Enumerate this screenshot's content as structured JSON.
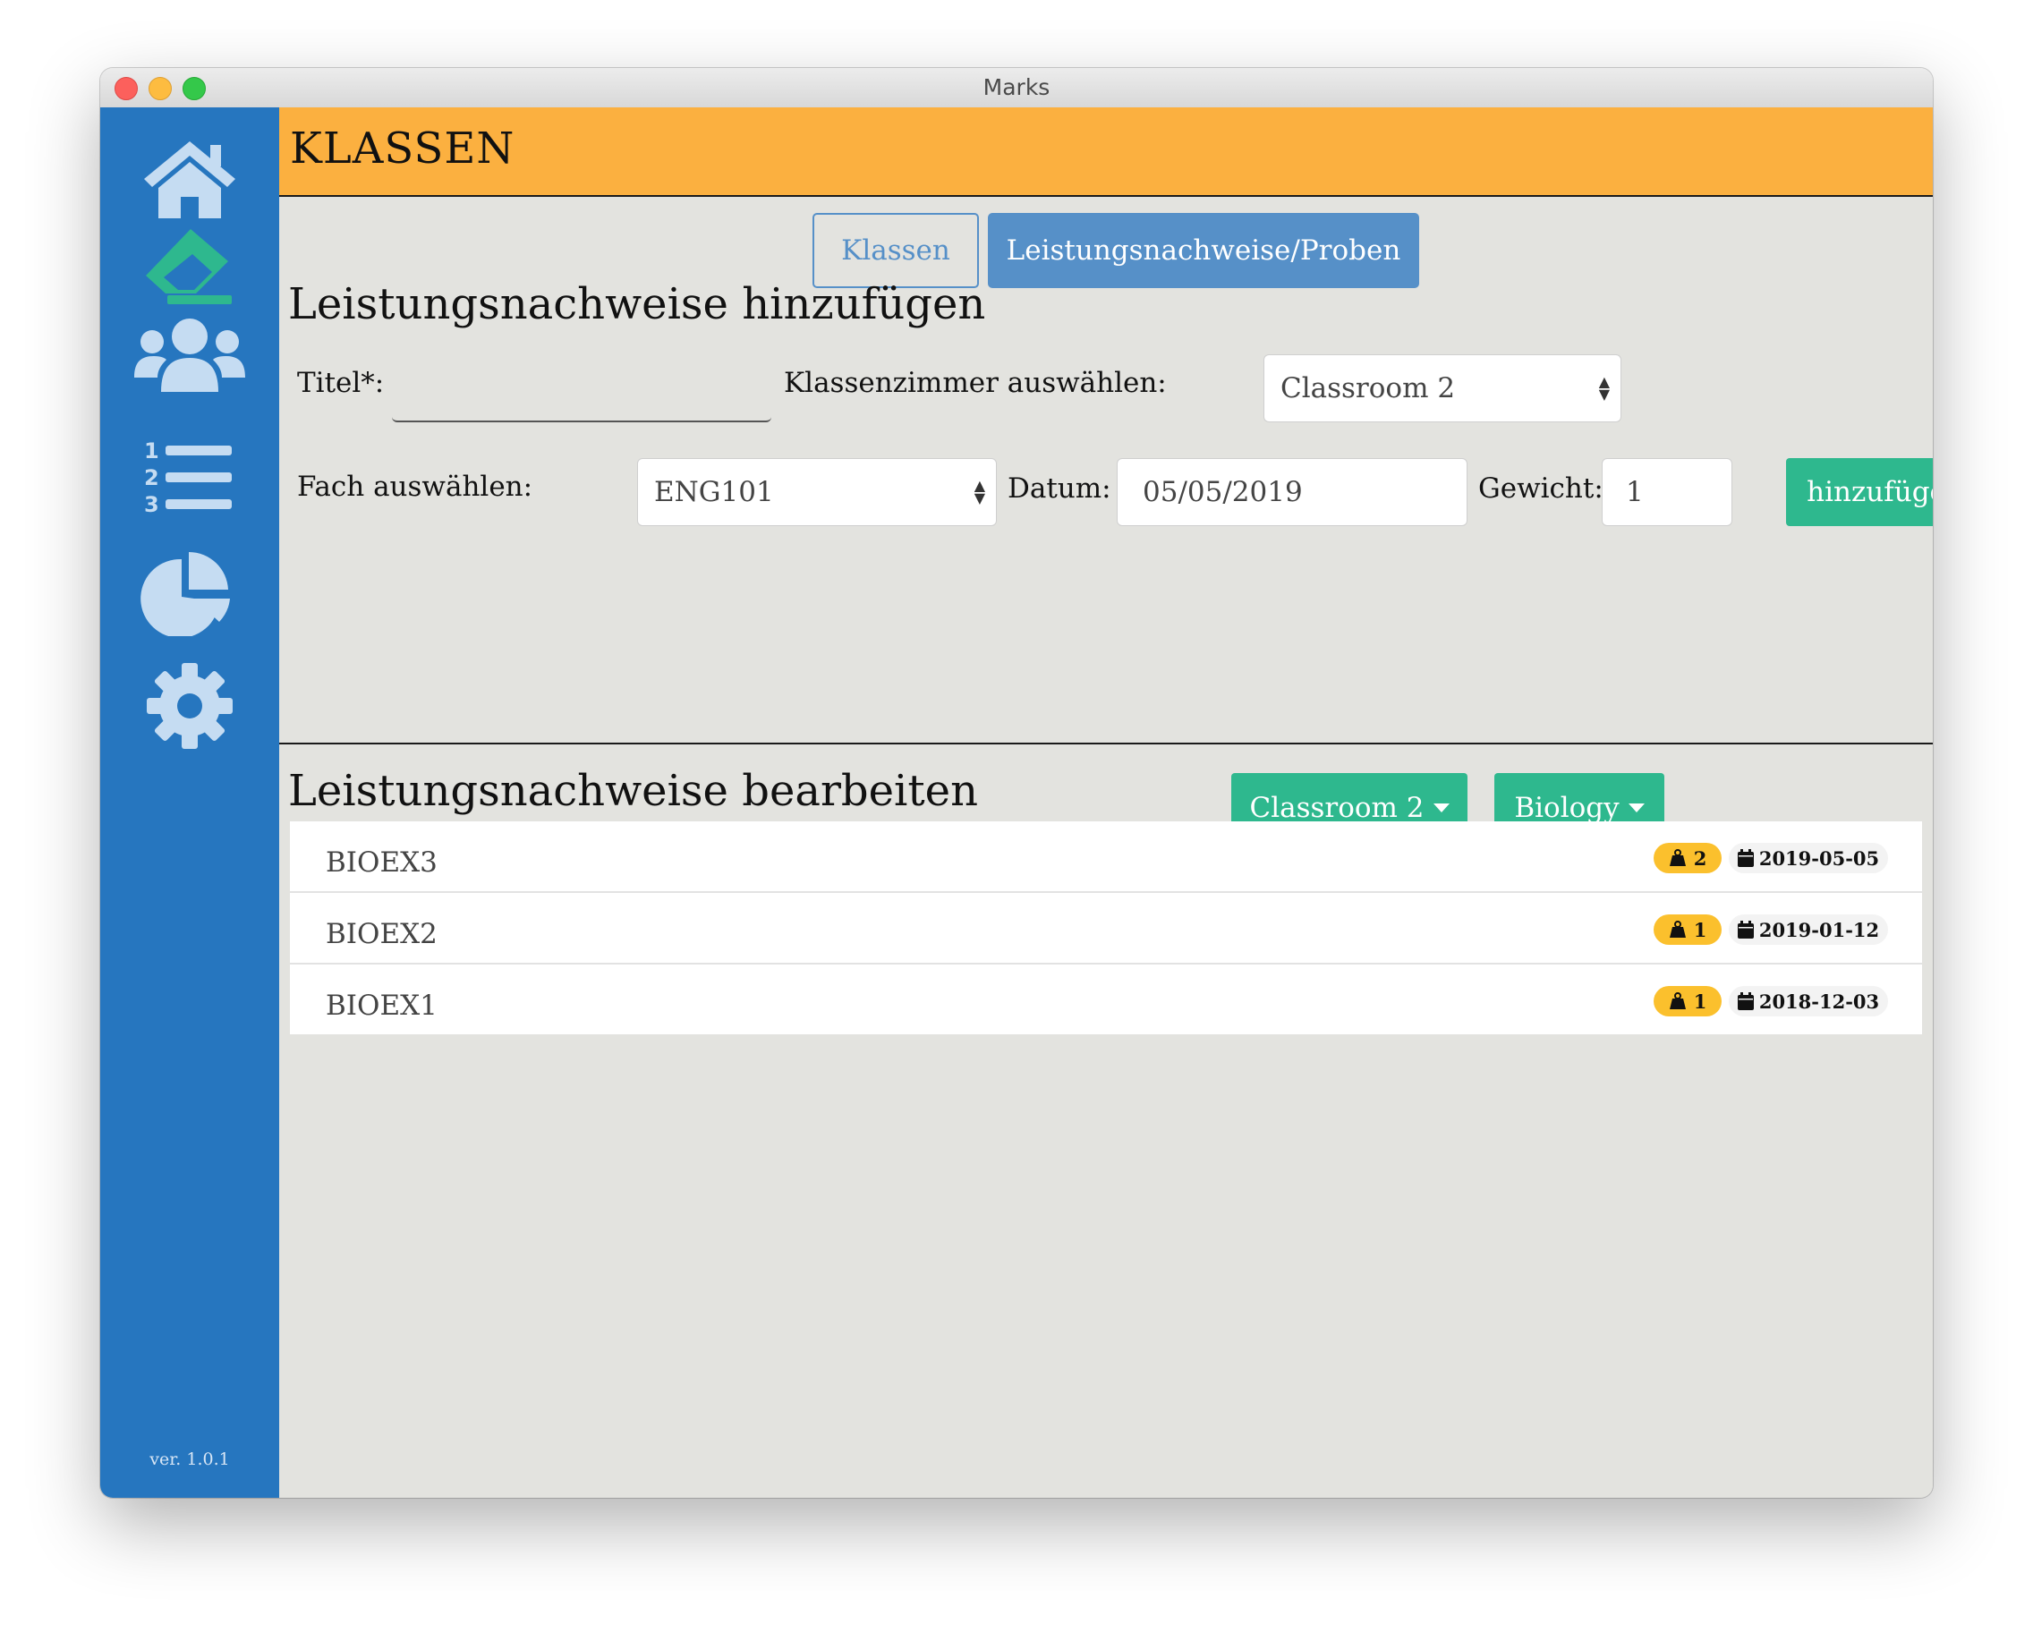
{
  "window": {
    "title": "Marks"
  },
  "sidebar": {
    "items": [
      {
        "icon": "home-icon",
        "active": false
      },
      {
        "icon": "eraser-icon",
        "active": true
      },
      {
        "icon": "users-icon",
        "active": false
      },
      {
        "icon": "list-ol-icon",
        "active": false
      },
      {
        "icon": "chart-pie-icon",
        "active": false
      },
      {
        "icon": "cog-icon",
        "active": false
      }
    ],
    "version": "ver. 1.0.1"
  },
  "colors": {
    "sidebar": "#2676bf",
    "header": "#fbb040",
    "accent_green": "#2eb88e",
    "tab_blue": "#5690c8",
    "weight_badge": "#fbc02d",
    "active_icon": "#2eb88e",
    "inactive_icon": "#c5dcf2"
  },
  "header": {
    "title": "KLASSEN"
  },
  "tabs": [
    {
      "label": "Klassen",
      "active": false
    },
    {
      "label": "Leistungsnachweise/Proben",
      "active": true
    }
  ],
  "add_section": {
    "title": "Leistungsnachweise hinzufügen",
    "title_label": "Titel*:",
    "title_value": "",
    "classroom_label": "Klassenzimmer auswählen:",
    "classroom_value": "Classroom 2",
    "subject_label": "Fach auswählen:",
    "subject_value": "ENG101",
    "date_label": "Datum:",
    "date_value": "05/05/2019",
    "weight_label": "Gewicht:",
    "weight_value": "1",
    "add_button": "hinzufügen"
  },
  "edit_section": {
    "title": "Leistungsnachweise bearbeiten",
    "classroom_filter": "Classroom 2",
    "subject_filter": "Biology",
    "items": [
      {
        "title": "BIOEX3",
        "weight": "2",
        "date": "2019-05-05"
      },
      {
        "title": "BIOEX2",
        "weight": "1",
        "date": "2019-01-12"
      },
      {
        "title": "BIOEX1",
        "weight": "1",
        "date": "2018-12-03"
      }
    ]
  }
}
